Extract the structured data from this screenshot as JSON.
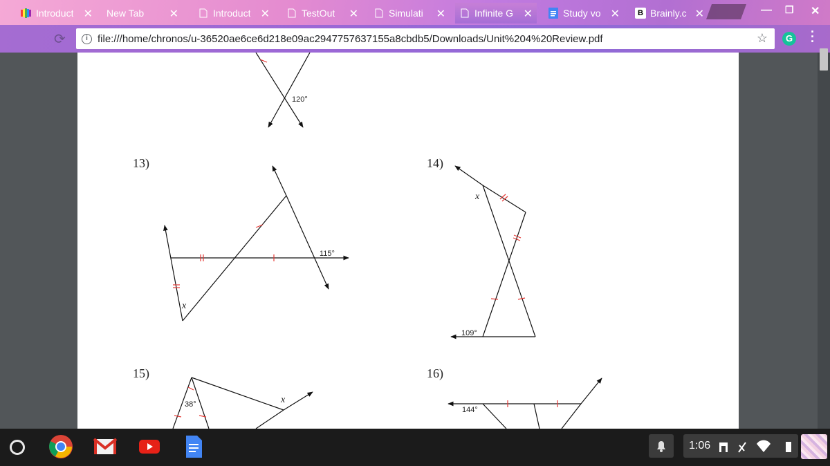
{
  "tabs": [
    {
      "label": "Introduct",
      "icon": "rainbow-app-icon"
    },
    {
      "label": "New Tab",
      "icon": ""
    },
    {
      "label": "Introduct",
      "icon": "page-icon"
    },
    {
      "label": "TestOut",
      "icon": "page-icon"
    },
    {
      "label": "Simulati",
      "icon": "page-icon"
    },
    {
      "label": "Infinite G",
      "icon": "page-icon"
    },
    {
      "label": "Study vo",
      "icon": "google-docs-icon"
    },
    {
      "label": "Brainly.c",
      "icon": "brainly-icon"
    }
  ],
  "toolbar": {
    "url": "file:///home/chronos/u-36520ae6ce6d218e09ac2947757637155a8cbdb5/Downloads/Unit%204%20Review.pdf"
  },
  "pdf": {
    "top_figure": {
      "angle": "120°"
    },
    "problems": [
      {
        "number": "13)",
        "angle": "115°",
        "variable": "x"
      },
      {
        "number": "14)",
        "angle": "109°",
        "variable": "x"
      },
      {
        "number": "15)",
        "angle": "38°",
        "variable": "x"
      },
      {
        "number": "16)",
        "angle": "144°"
      }
    ]
  },
  "shelf": {
    "apps": [
      "chrome-icon",
      "gmail-icon",
      "youtube-icon",
      "google-docs-icon"
    ],
    "time": "1:06"
  },
  "colors": {
    "tick_marks": "#e53935",
    "viewer_bg": "#525659"
  }
}
